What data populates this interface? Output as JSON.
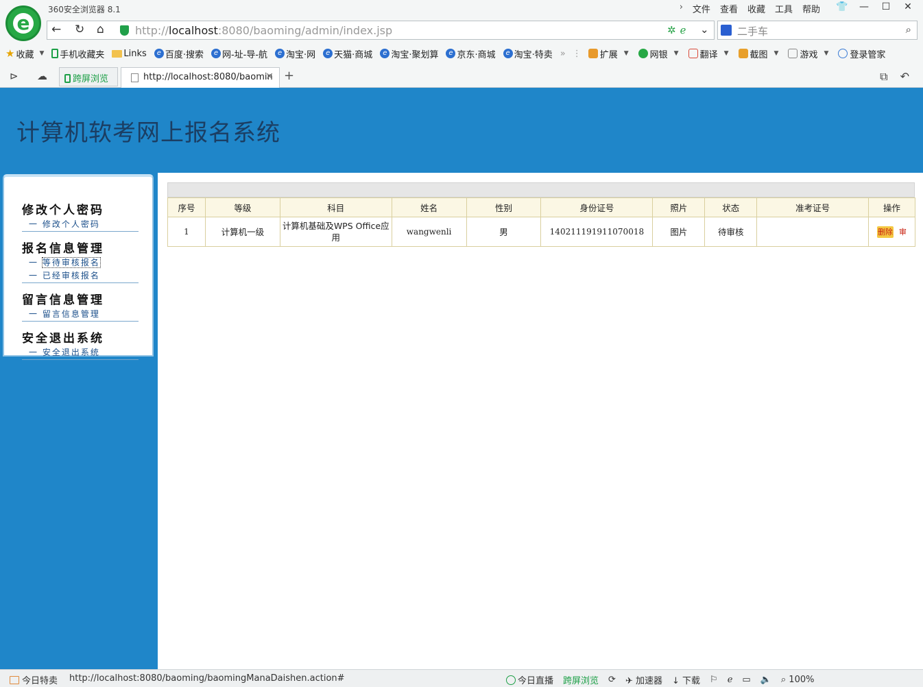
{
  "browser": {
    "title": "360安全浏览器 8.1",
    "menu": [
      "文件",
      "查看",
      "收藏",
      "工具",
      "帮助"
    ],
    "address": {
      "scheme_host": "http://",
      "host": "localhost",
      "rest": ":8080/baoming/admin/index.jsp"
    },
    "search_text": "二手车",
    "bookmarks": [
      {
        "label": "收藏",
        "icon": "star-icon"
      },
      {
        "label": "手机收藏夹",
        "icon": "phone-icon"
      },
      {
        "label": "Links",
        "icon": "folder-icon"
      },
      {
        "label": "百度·搜索",
        "icon": "ie-icon"
      },
      {
        "label": "网-址-导-航",
        "icon": "ie-icon"
      },
      {
        "label": "淘宝·网",
        "icon": "ie-icon"
      },
      {
        "label": "天猫·商城",
        "icon": "ie-icon"
      },
      {
        "label": "淘宝·聚划算",
        "icon": "ie-icon"
      },
      {
        "label": "京东·商城",
        "icon": "ie-icon"
      },
      {
        "label": "淘宝·特卖",
        "icon": "ie-icon"
      }
    ],
    "tools": [
      {
        "label": "扩展",
        "color": "#e89a2c"
      },
      {
        "label": "网银",
        "color": "#27a845"
      },
      {
        "label": "翻译",
        "color": "#d94a3a"
      },
      {
        "label": "截图",
        "color": "#e8a02c"
      },
      {
        "label": "游戏",
        "color": "#888888"
      },
      {
        "label": "登录管家",
        "color": "#3a7bd5"
      }
    ],
    "tabs": {
      "special": "跨屏浏览",
      "active": "http://localhost:8080/baomin"
    }
  },
  "site": {
    "title": "计算机软考网上报名系统"
  },
  "sidebar": {
    "groups": [
      {
        "head": "修改个人密码",
        "links": [
          "修改个人密码"
        ]
      },
      {
        "head": "报名信息管理",
        "links": [
          "等待审核报名",
          "已经审核报名"
        ]
      },
      {
        "head": "留言信息管理",
        "links": [
          "留言信息管理"
        ]
      },
      {
        "head": "安全退出系统",
        "links": [
          "安全退出系统"
        ]
      }
    ]
  },
  "table": {
    "headers": [
      "序号",
      "等级",
      "科目",
      "姓名",
      "性别",
      "身份证号",
      "照片",
      "状态",
      "准考证号",
      "操作"
    ],
    "rows": [
      [
        "1",
        "计算机一级",
        "计算机基础及WPS Office应用",
        "wangwenli",
        "男",
        "140211191911070018",
        "图片",
        "待审核",
        "",
        ""
      ]
    ],
    "actions": {
      "delete": "删除",
      "review": "审"
    }
  },
  "status": {
    "left": "今日特卖",
    "url": "http://localhost:8080/baoming/baomingManaDaishen.action#",
    "items": [
      "今日直播",
      "跨屏浏览",
      "加速器",
      "下载"
    ],
    "zoom": "100%"
  },
  "colors": {
    "page_bg": "#1f86c9",
    "title": "#1b3e63",
    "table_head_bg": "#fbf7e4"
  }
}
